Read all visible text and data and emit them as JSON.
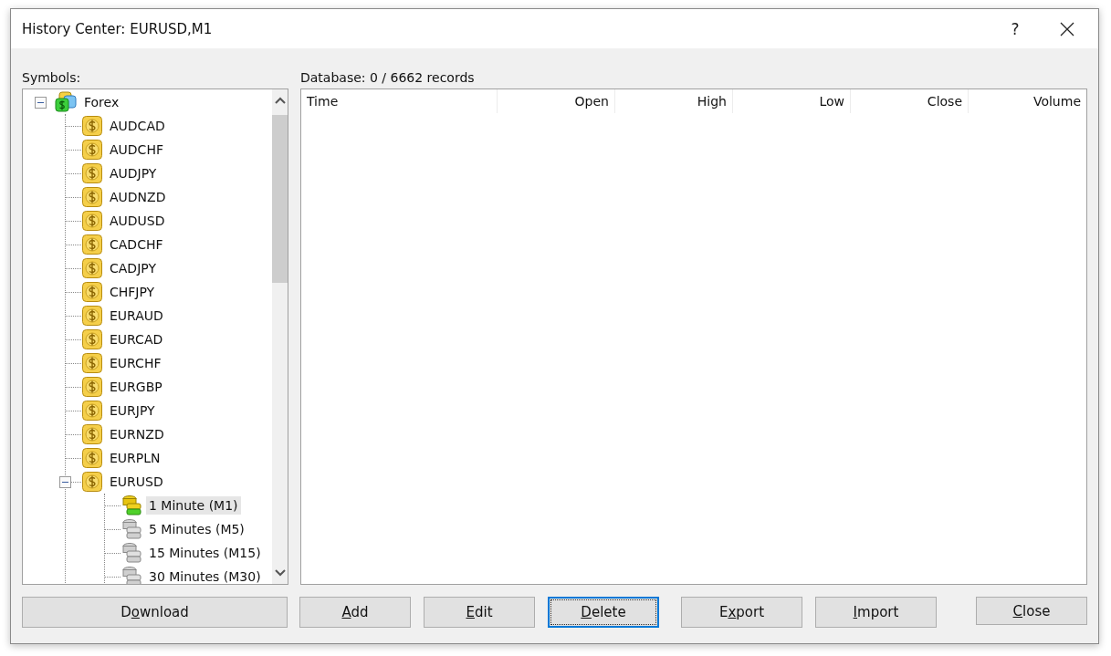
{
  "window": {
    "title": "History Center: EURUSD,M1",
    "help_label": "?"
  },
  "symbols_label": "Symbols:",
  "tree": [
    {
      "label": "Forex",
      "kind": "group",
      "expanded": true,
      "selected": false,
      "children": [
        {
          "label": "AUDCAD",
          "kind": "symbol",
          "selected": false
        },
        {
          "label": "AUDCHF",
          "kind": "symbol",
          "selected": false
        },
        {
          "label": "AUDJPY",
          "kind": "symbol",
          "selected": false
        },
        {
          "label": "AUDNZD",
          "kind": "symbol",
          "selected": false
        },
        {
          "label": "AUDUSD",
          "kind": "symbol",
          "selected": false
        },
        {
          "label": "CADCHF",
          "kind": "symbol",
          "selected": false
        },
        {
          "label": "CADJPY",
          "kind": "symbol",
          "selected": false
        },
        {
          "label": "CHFJPY",
          "kind": "symbol",
          "selected": false
        },
        {
          "label": "EURAUD",
          "kind": "symbol",
          "selected": false
        },
        {
          "label": "EURCAD",
          "kind": "symbol",
          "selected": false
        },
        {
          "label": "EURCHF",
          "kind": "symbol",
          "selected": false
        },
        {
          "label": "EURGBP",
          "kind": "symbol",
          "selected": false
        },
        {
          "label": "EURJPY",
          "kind": "symbol",
          "selected": false
        },
        {
          "label": "EURNZD",
          "kind": "symbol",
          "selected": false
        },
        {
          "label": "EURPLN",
          "kind": "symbol",
          "selected": false
        },
        {
          "label": "EURUSD",
          "kind": "symbol",
          "expanded": true,
          "selected": false,
          "children": [
            {
              "label": "1 Minute (M1)",
              "kind": "period",
              "has_data": true,
              "selected": true
            },
            {
              "label": "5 Minutes (M5)",
              "kind": "period",
              "has_data": false,
              "selected": false
            },
            {
              "label": "15 Minutes (M15)",
              "kind": "period",
              "has_data": false,
              "selected": false
            },
            {
              "label": "30 Minutes (M30)",
              "kind": "period",
              "has_data": false,
              "selected": false
            }
          ]
        }
      ]
    }
  ],
  "database_label": "Database: 0 / 6662 records",
  "table": {
    "columns": [
      {
        "label": "Time",
        "kind": "text"
      },
      {
        "label": "Open",
        "kind": "number"
      },
      {
        "label": "High",
        "kind": "number"
      },
      {
        "label": "Low",
        "kind": "number"
      },
      {
        "label": "Close",
        "kind": "number"
      },
      {
        "label": "Volume",
        "kind": "number"
      }
    ]
  },
  "download_button": {
    "before": "D",
    "key": "o",
    "after": "wnload",
    "focused": false
  },
  "buttons": [
    {
      "key": "A",
      "after": "dd",
      "focused": false
    },
    {
      "key": "E",
      "after": "dit",
      "focused": false
    },
    {
      "key": "D",
      "after": "elete",
      "focused": true
    },
    {
      "before": "E",
      "key": "x",
      "after": "port",
      "focused": false
    },
    {
      "key": "I",
      "after": "mport",
      "focused": false
    }
  ],
  "close_button": {
    "key": "C",
    "after": "lose",
    "focused": false
  }
}
